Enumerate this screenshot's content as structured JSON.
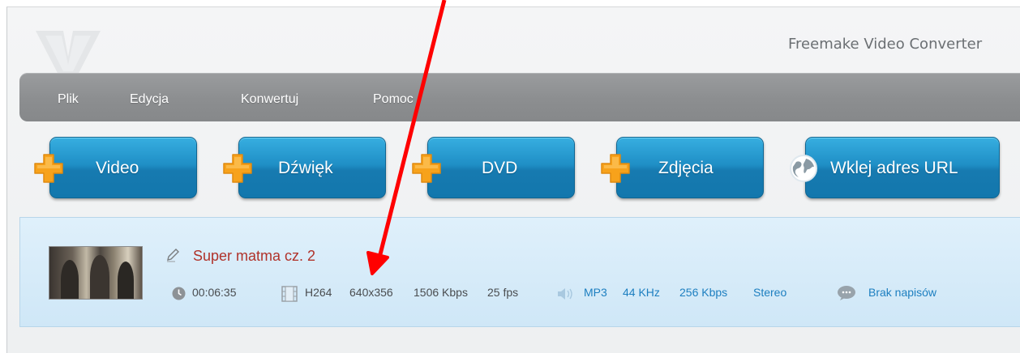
{
  "app": {
    "title": "Freemake Video Converter"
  },
  "menu": {
    "items": [
      "Plik",
      "Edycja",
      "Konwertuj",
      "Pomoc"
    ]
  },
  "toolbar": {
    "video": "Video",
    "audio": "Dźwięk",
    "dvd": "DVD",
    "photos": "Zdjęcia",
    "url": "Wklej adres URL"
  },
  "file": {
    "title": "Super matma cz. 2",
    "duration": "00:06:35",
    "video": {
      "codec": "H264",
      "resolution": "640x356",
      "bitrate": "1506 Kbps",
      "fps": "25 fps"
    },
    "audio": {
      "codec": "MP3",
      "rate": "44 KHz",
      "bitrate": "256 Kbps",
      "channels": "Stereo"
    },
    "subtitles": "Brak napisów"
  },
  "colors": {
    "menubar": "#8c8e90",
    "button": "#1f8fc6",
    "plus": "#f7a21b",
    "title": "#b0322a",
    "link": "#1d7fc0",
    "arrow": "#ff0000"
  },
  "icons": [
    "app-logo-icon",
    "plus-icon",
    "globe-icon",
    "pencil-icon",
    "clock-icon",
    "film-icon",
    "speaker-icon",
    "speech-bubble-icon"
  ]
}
